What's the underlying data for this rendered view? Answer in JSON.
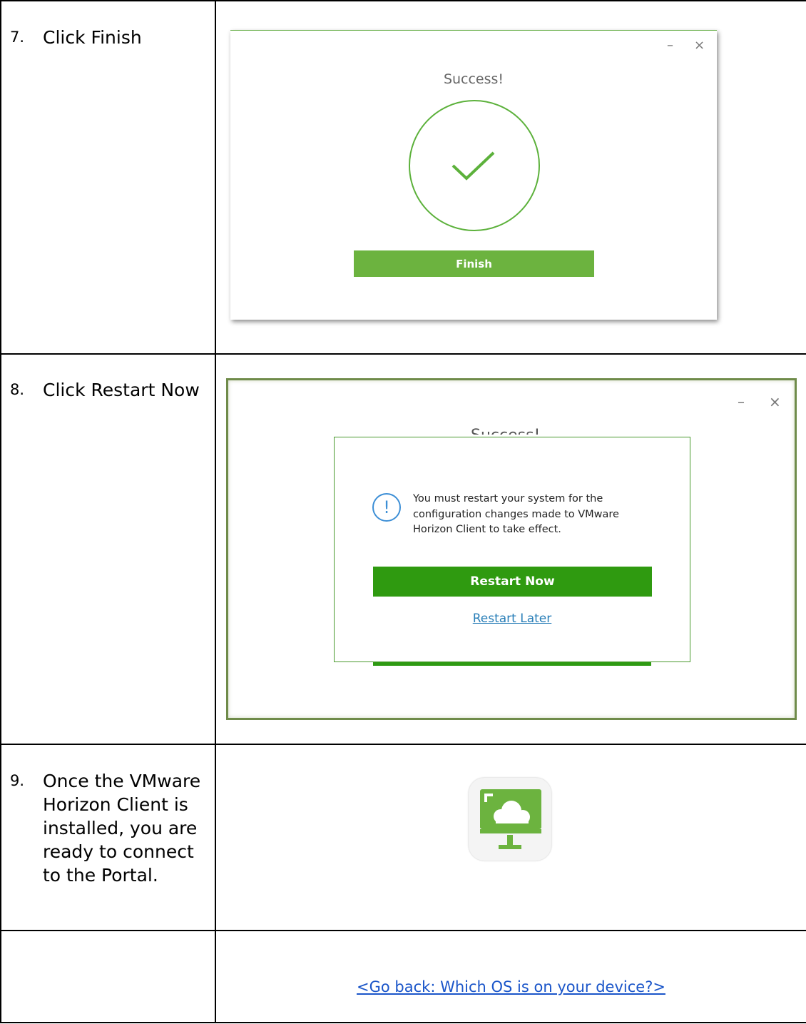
{
  "rows": [
    {
      "number": "7.",
      "instruction": "Click Finish",
      "screenshot": {
        "title": "Success!",
        "button": "Finish",
        "controls": {
          "minimize": "–",
          "close": "×"
        },
        "accent_color": "#6cb33f"
      }
    },
    {
      "number": "8.",
      "instruction": "Click Restart Now",
      "screenshot": {
        "behind_title": "Success!",
        "message": "You must restart your system for the configuration changes made to VMware Horizon Client to take effect.",
        "info_icon": "!",
        "primary_button": "Restart Now",
        "secondary_link": "Restart Later",
        "controls": {
          "minimize": "–",
          "close": "×"
        },
        "accent_color": "#2f9a10"
      }
    },
    {
      "number": "9.",
      "instruction": "Once the VMware Horizon Client is installed, you are ready to connect to the Portal.",
      "icon": "vmware-horizon-client-icon"
    },
    {
      "number": "",
      "instruction": "",
      "link": "<Go back: Which OS is on your device?>"
    }
  ]
}
